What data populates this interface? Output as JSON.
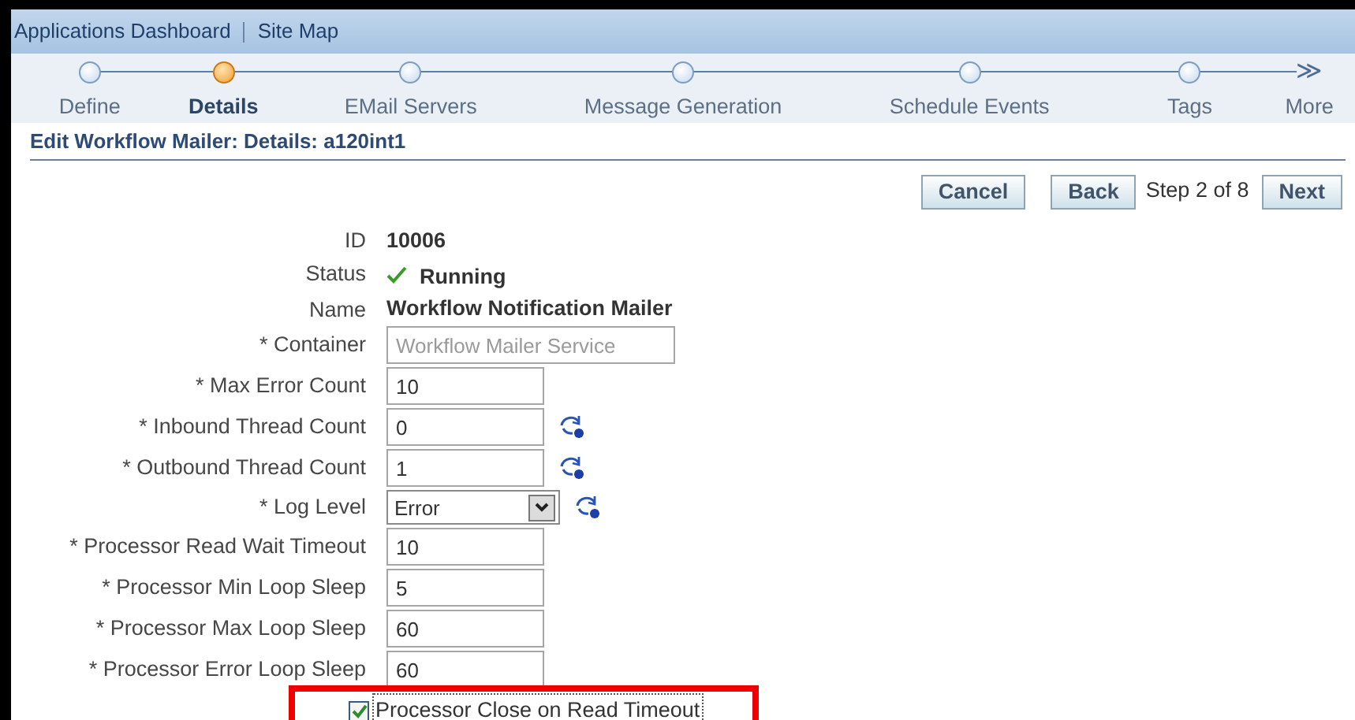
{
  "global_links": [
    "Applications Dashboard",
    "Site Map"
  ],
  "train": [
    {
      "kind": "step",
      "label": "Define",
      "selected": false
    },
    {
      "kind": "step",
      "label": "Details",
      "selected": true
    },
    {
      "kind": "step",
      "label": "EMail Servers",
      "selected": false
    },
    {
      "kind": "step",
      "label": "Message Generation",
      "selected": false
    },
    {
      "kind": "step",
      "label": "Schedule Events",
      "selected": false
    },
    {
      "kind": "step",
      "label": "Tags",
      "selected": false
    },
    {
      "kind": "more",
      "label": "More",
      "symbol": "≫"
    }
  ],
  "page_title": "Edit Workflow Mailer: Details: a120int1",
  "buttons": [
    {
      "label": "Cancel"
    },
    {
      "label": "Back"
    }
  ],
  "step_text": "Step 2 of 8",
  "next_button": "Next",
  "fields": [
    {
      "kind": "display",
      "label": "ID",
      "value": "10006"
    },
    {
      "kind": "status",
      "label": "Status",
      "value": "Running"
    },
    {
      "kind": "display",
      "label": "Name",
      "value": "Workflow Notification Mailer"
    },
    {
      "kind": "readonly",
      "label": "* Container",
      "value": "Workflow Mailer Service",
      "disabled": true
    },
    {
      "kind": "text",
      "label": "* Max Error Count",
      "value": "10"
    },
    {
      "kind": "text-refresh",
      "label": "* Inbound Thread Count",
      "value": "0"
    },
    {
      "kind": "text-refresh",
      "label": "* Outbound Thread Count",
      "value": "1"
    },
    {
      "kind": "select-refresh",
      "label": "* Log Level",
      "value": "Error"
    },
    {
      "kind": "text",
      "label": "* Processor Read Wait Timeout",
      "value": "10"
    },
    {
      "kind": "text",
      "label": "* Processor Min Loop Sleep",
      "value": "5"
    },
    {
      "kind": "text",
      "label": "* Processor Max Loop Sleep",
      "value": "60"
    },
    {
      "kind": "text",
      "label": "* Processor Error Loop Sleep",
      "value": "60"
    },
    {
      "kind": "checkbox",
      "label": "Processor Close on Read Timeout",
      "checked": true
    }
  ]
}
